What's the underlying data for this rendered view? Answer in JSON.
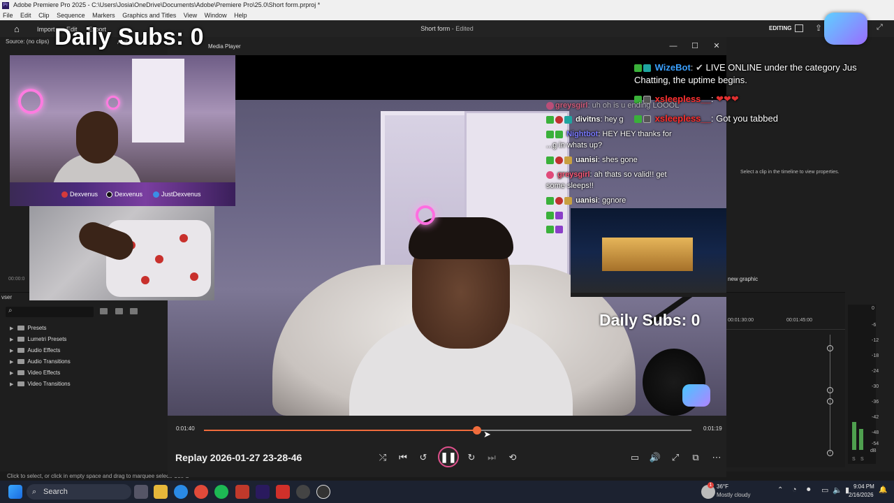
{
  "window": {
    "title": "Adobe Premiere Pro 2025 - C:\\Users\\Josia\\OneDrive\\Documents\\Adobe\\Premiere Pro\\25.0\\Short form.prproj *"
  },
  "menu": [
    "File",
    "Edit",
    "Clip",
    "Sequence",
    "Markers",
    "Graphics and Titles",
    "View",
    "Window",
    "Help"
  ],
  "header": {
    "import": "Import",
    "edit": "Edit",
    "export": "Export",
    "project_title": "Short form",
    "project_state": "- Edited",
    "workspace": "EDITING"
  },
  "source_panel": {
    "label": "Source: (no clips)",
    "audio_tab": "Audio",
    "timecode": "00:00:0"
  },
  "media_player": {
    "title": "Media Player"
  },
  "overlay": {
    "daily_subs_top": "Daily Subs: 0",
    "daily_subs_video": "Daily Subs: 0"
  },
  "socials": [
    {
      "name": "Dexvenus",
      "icon": "instagram-icon",
      "color": "#d63a3a"
    },
    {
      "name": "Dexvenus",
      "icon": "tiktok-icon",
      "color": "#111111"
    },
    {
      "name": "JustDexvenus",
      "icon": "twitch-icon",
      "color": "#3a8ee6"
    }
  ],
  "chat": {
    "top": [
      {
        "user": "WizeBot",
        "user_color": "#3aa0ff",
        "text": "LIVE ONLINE under the category Jus"
      },
      {
        "user": "",
        "user_color": "#ffffff",
        "text": "Chatting, the uptime begins."
      },
      {
        "user": "xsleepless__",
        "user_color": "#ff3030",
        "text": "❤❤❤"
      },
      {
        "user": "xsleepless__",
        "user_color": "#ff3030",
        "text": "Got you tabbed"
      }
    ],
    "video": [
      {
        "user": "greysgirl",
        "user_color": "#ff5a7a",
        "text": "uh oh is u ending LOOOL"
      },
      {
        "user": "divitns",
        "user_color": "#ffffff",
        "text": "hey g"
      },
      {
        "user": "Nightbot",
        "user_color": "#7a7aff",
        "text": "HEY HEY thanks for"
      },
      {
        "user": "",
        "user_color": "#ffffff",
        "text": "...g in whats up?"
      },
      {
        "user": "uanisi",
        "user_color": "#ffffff",
        "text": "shes gone"
      },
      {
        "user": "greysgirl",
        "user_color": "#ff5a7a",
        "text": "ah thats so valid!! get"
      },
      {
        "user": "",
        "user_color": "#ffffff",
        "text": "some sleeps!!"
      },
      {
        "user": "uanisi",
        "user_color": "#ffffff",
        "text": "ggnore"
      }
    ]
  },
  "effects_panel": {
    "tab": "vser",
    "search_placeholder": "",
    "items": [
      "Presets",
      "Lumetri Presets",
      "Audio Effects",
      "Audio Transitions",
      "Video Effects",
      "Video Transitions"
    ]
  },
  "properties": {
    "hint": "Select a clip in the timeline to view properties.",
    "new_graphic": "new graphic"
  },
  "timeline": {
    "marks": [
      "00:01:30:00",
      "00:01:45:00"
    ]
  },
  "meter_labels": [
    "0",
    "-6",
    "-12",
    "-18",
    "-24",
    "-30",
    "-36",
    "-42",
    "-48",
    "-54",
    "dB"
  ],
  "meter_bottom": [
    "S",
    "S"
  ],
  "player": {
    "elapsed": "0:01:40",
    "remaining": "0:01:19",
    "progress": 0.56,
    "replay_title": "Replay 2026-01-27 23-28-46"
  },
  "status_bar": {
    "text": "Click to select, or click in empty space and drag to marquee select. Use S"
  },
  "taskbar": {
    "search": "Search",
    "weather_temp": "36°F",
    "weather_desc": "Mostly cloudy",
    "time": "9:04 PM",
    "date": "2/16/2026",
    "notification_count": "1"
  },
  "colors": {
    "accent": "#f06c3c",
    "play_ring": "#e0508c"
  }
}
